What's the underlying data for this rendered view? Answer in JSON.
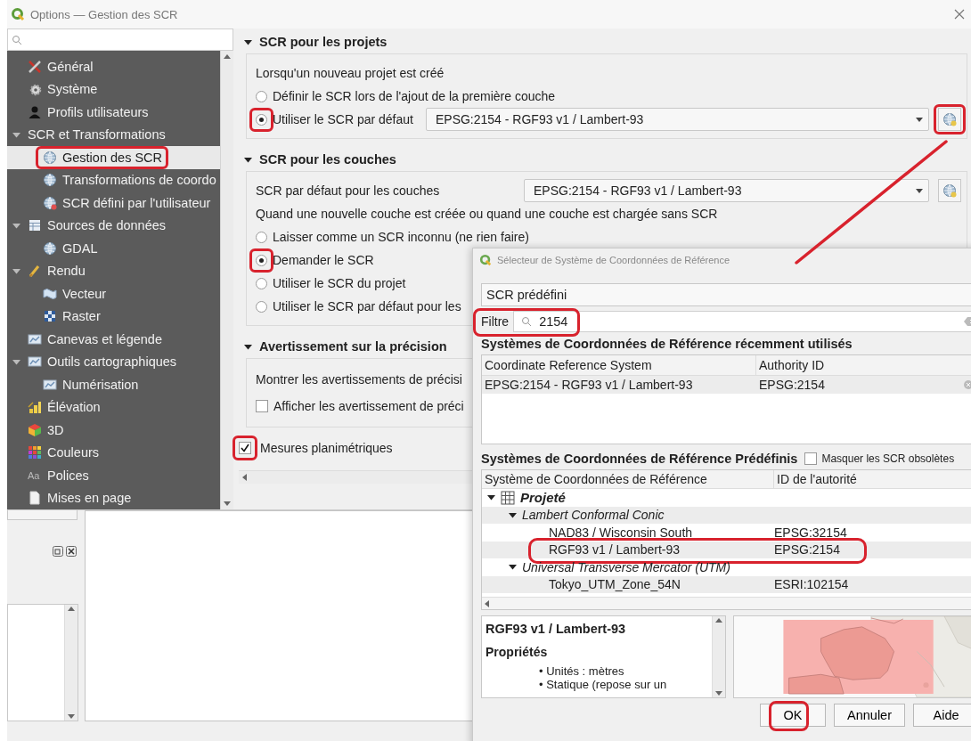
{
  "options_window": {
    "title": "Options — Gestion des SCR",
    "sidebar": {
      "items": [
        {
          "label": "Général",
          "selected": false,
          "highlighted": false
        },
        {
          "label": "Système",
          "selected": false,
          "highlighted": false
        },
        {
          "label": "Profils utilisateurs",
          "selected": false,
          "highlighted": false
        },
        {
          "label": "SCR et Transformations",
          "selected": false,
          "highlighted": false,
          "expanded": true,
          "children": [
            {
              "label": "Gestion des SCR",
              "selected": true,
              "highlighted": true
            },
            {
              "label": "Transformations de coordo",
              "selected": false,
              "highlighted": false
            },
            {
              "label": "SCR défini par l'utilisateur",
              "selected": false,
              "highlighted": false
            }
          ]
        },
        {
          "label": "Sources de données",
          "selected": false,
          "highlighted": false,
          "expanded": true,
          "children": [
            {
              "label": "GDAL",
              "selected": false,
              "highlighted": false
            }
          ]
        },
        {
          "label": "Rendu",
          "selected": false,
          "highlighted": false,
          "expanded": true,
          "children": [
            {
              "label": "Vecteur",
              "selected": false,
              "highlighted": false
            },
            {
              "label": "Raster",
              "selected": false,
              "highlighted": false
            }
          ]
        },
        {
          "label": "Canevas et légende",
          "selected": false,
          "highlighted": false
        },
        {
          "label": "Outils cartographiques",
          "selected": false,
          "highlighted": false,
          "expanded": true,
          "children": [
            {
              "label": "Numérisation",
              "selected": false,
              "highlighted": false
            }
          ]
        },
        {
          "label": "Élévation",
          "selected": false,
          "highlighted": false
        },
        {
          "label": "3D",
          "selected": false,
          "highlighted": false
        },
        {
          "label": "Couleurs",
          "selected": false,
          "highlighted": false
        },
        {
          "label": "Polices",
          "selected": false,
          "highlighted": false,
          "icon_text": "Aa"
        },
        {
          "label": "Mises en page",
          "selected": false,
          "highlighted": false
        }
      ]
    },
    "sections": [
      {
        "title": "SCR pour les projets",
        "expanded": true,
        "rows": [
          {
            "kind": "text",
            "text": "Lorsqu'un nouveau projet est créé"
          },
          {
            "kind": "radio",
            "label": "Définir le SCR lors de l'ajout de la première couche",
            "selected": false,
            "highlighted": false
          },
          {
            "kind": "radio",
            "label": "Utiliser le SCR par défaut",
            "selected": true,
            "highlighted": true,
            "combo": {
              "value": "EPSG:2154 - RGF93 v1 / Lambert-93",
              "button_highlighted": true
            }
          }
        ]
      },
      {
        "title": "SCR pour les couches",
        "expanded": true,
        "rows": [
          {
            "kind": "combo_row",
            "label": "SCR par défaut pour les couches",
            "combo": {
              "value": "EPSG:2154 - RGF93 v1 / Lambert-93",
              "button_highlighted": false
            }
          },
          {
            "kind": "text",
            "text": "Quand une nouvelle couche est créée ou quand une couche est chargée sans SCR"
          },
          {
            "kind": "radio",
            "label": "Laisser comme un SCR inconnu (ne rien faire)",
            "selected": false,
            "highlighted": false
          },
          {
            "kind": "radio",
            "label": "Demander le SCR",
            "selected": true,
            "highlighted": true
          },
          {
            "kind": "radio",
            "label": "Utiliser le SCR du projet",
            "selected": false,
            "highlighted": false
          },
          {
            "kind": "radio",
            "label": "Utiliser le SCR par défaut pour les",
            "selected": false,
            "highlighted": false
          }
        ]
      },
      {
        "title": "Avertissement sur la précision",
        "expanded": true,
        "rows": [
          {
            "kind": "text",
            "text": "Montrer les avertissements de précisi"
          },
          {
            "kind": "checkbox",
            "label": "Afficher les avertissement de préci",
            "checked": false,
            "highlighted": false
          }
        ]
      }
    ],
    "planimetric": {
      "label": "Mesures planimétriques",
      "checked": true,
      "highlighted": true
    }
  },
  "crs_dialog": {
    "title": "Sélecteur de Système de Coordonnées de Référence",
    "mode": "SCR prédéfini",
    "filter": {
      "label": "Filtre",
      "value": "2154",
      "highlighted": true
    },
    "recent": {
      "title": "Systèmes de Coordonnées de Référence récemment utilisés",
      "columns": [
        "Coordinate Reference System",
        "Authority ID"
      ],
      "rows": [
        {
          "cells": [
            "EPSG:2154 - RGF93 v1 / Lambert-93",
            "EPSG:2154"
          ]
        }
      ]
    },
    "predefined": {
      "title": "Systèmes de Coordonnées de Référence Prédéfinis",
      "hide_deprecated": {
        "label": "Masquer les SCR obsolètes",
        "checked": false
      },
      "columns": [
        "Système de Coordonnées de Référence",
        "ID de l'autorité"
      ],
      "tree": [
        {
          "label": "Projeté",
          "expanded": true,
          "children": [
            {
              "label": "Lambert Conformal Conic",
              "expanded": true,
              "children": [
                {
                  "label": "NAD83 / Wisconsin South",
                  "authority": "EPSG:32154",
                  "highlighted": false
                },
                {
                  "label": "RGF93 v1 / Lambert-93",
                  "authority": "EPSG:2154",
                  "highlighted": true
                }
              ]
            },
            {
              "label": "Universal Transverse Mercator (UTM)",
              "expanded": true,
              "children": [
                {
                  "label": "Tokyo_UTM_Zone_54N",
                  "authority": "ESRI:102154",
                  "highlighted": false
                }
              ]
            }
          ]
        }
      ]
    },
    "details": {
      "title": "RGF93 v1 / Lambert-93",
      "heading": "Propriétés",
      "bullets": [
        "• Unités : mètres",
        "• Statique (repose sur un"
      ]
    },
    "buttons": [
      {
        "label": "OK",
        "highlighted": true
      },
      {
        "label": "Annuler",
        "highlighted": false
      },
      {
        "label": "Aide",
        "highlighted": false
      }
    ]
  }
}
